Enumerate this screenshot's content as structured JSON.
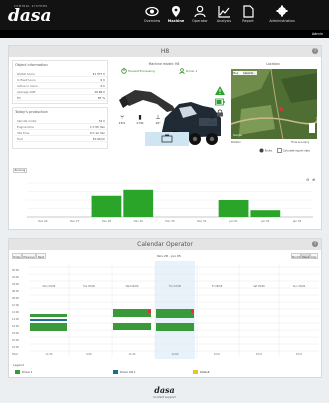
{
  "app": {
    "logo_tagline": "CONTROL SYSTEMS",
    "logo_word": "dasa",
    "user": "Admin"
  },
  "nav": [
    {
      "label": "Overview",
      "icon": "eye-icon",
      "active": false
    },
    {
      "label": "Machine",
      "icon": "pin-icon",
      "active": true
    },
    {
      "label": "Operator",
      "icon": "person-icon",
      "active": false
    },
    {
      "label": "Analysis",
      "icon": "chart-icon",
      "active": false
    },
    {
      "label": "Report",
      "icon": "document-icon",
      "active": false
    },
    {
      "label": "Administration",
      "icon": "gear-icon",
      "active": false
    }
  ],
  "machine_panel": {
    "title": "H8",
    "object_info": {
      "title": "Object information",
      "rows": [
        {
          "key": "Global hours",
          "value": "31 377 h"
        },
        {
          "key": "In fleet hours",
          "value": "0 h"
        },
        {
          "key": "Active in hours",
          "value": "0 h"
        },
        {
          "key": "Average shift",
          "value": "10.69 h"
        },
        {
          "key": "Fill",
          "value": "87 %"
        }
      ]
    },
    "production": {
      "title": "Today's production",
      "rows": [
        {
          "key": "Spindle motor",
          "value": "31 h"
        },
        {
          "key": "Engine time",
          "value": "1 h 55 min"
        },
        {
          "key": "Idle time",
          "value": "0 h 12 min"
        },
        {
          "key": "Fuel",
          "value": "31.00 l/h"
        }
      ]
    },
    "machine_title": "Machine model: H8",
    "status_running": "Harvest Processing",
    "status_driver": "Driver 1",
    "stats": [
      {
        "icon": "chair-icon",
        "value": "18.5"
      },
      {
        "icon": "fuel-icon",
        "value": "1741"
      },
      {
        "icon": "thermometer-icon",
        "value": "16°"
      },
      {
        "icon": "pressure-icon",
        "value": "28.1"
      },
      {
        "icon": "rpm-icon",
        "value": "76.1"
      },
      {
        "icon": "power-icon",
        "value": "27.6"
      }
    ],
    "location": {
      "title": "Location",
      "map_tab_map": "Map",
      "map_tab_satellite": "Satellite",
      "map_brand": "Google",
      "coords_label": "Position",
      "time_label": "Time accuracy",
      "btn_route": "Route",
      "btn_export": "Calculate export data"
    },
    "timeline": {
      "tag": "Running",
      "dates_start": "Dec 26, 2017",
      "dates_end": "Jan 03, 2018",
      "y_label": "Operating hours"
    }
  },
  "chart_data": {
    "type": "bar",
    "title": "",
    "categories": [
      "Dec 26",
      "Dec 27",
      "Dec 28",
      "Dec 29",
      "Dec 30",
      "Dec 31",
      "Jan 01",
      "Jan 02",
      "Jan 03"
    ],
    "series": [
      {
        "values": [
          0,
          0,
          2.5,
          3.2,
          0,
          0,
          2.0,
          0.8,
          0
        ],
        "color": "#2aa52a"
      }
    ],
    "ylim": [
      0,
      4
    ],
    "xlabel": "",
    "ylabel": ""
  },
  "calendar": {
    "title": "Calendar Operator",
    "btn_today": "Today",
    "btn_prev": "Previous",
    "btn_next": "Next",
    "range": "Nov 28 – Jun 05",
    "btn_month": "Month",
    "btn_week": "Week",
    "btn_day": "Day",
    "days": [
      "Mon 04/06",
      "Tue 05/06",
      "Wed 06/06",
      "Thu 07/06",
      "Fri 08/06",
      "Sat 09/06",
      "Sun 10/06"
    ],
    "times": [
      "00:00",
      "02:00",
      "04:00",
      "06:00",
      "08:00",
      "10:00",
      "12:00",
      "14:00",
      "16:00",
      "18:00",
      "20:00",
      "22:00"
    ],
    "totals_label": "Total",
    "totals": [
      "11:30",
      "0:00",
      "11:15",
      "12:00",
      "0:0.0",
      "0:0.0",
      "0:0.0"
    ],
    "legend_title": "Legend",
    "legend": [
      {
        "label": "Driver 1",
        "color": "#3a9a3a"
      },
      {
        "label": "Driver Old 1",
        "color": "#1a6f8f"
      },
      {
        "label": "Default",
        "color": "#f0c420"
      }
    ]
  },
  "footer": {
    "logo": "dasa",
    "sub": "Contact support"
  }
}
